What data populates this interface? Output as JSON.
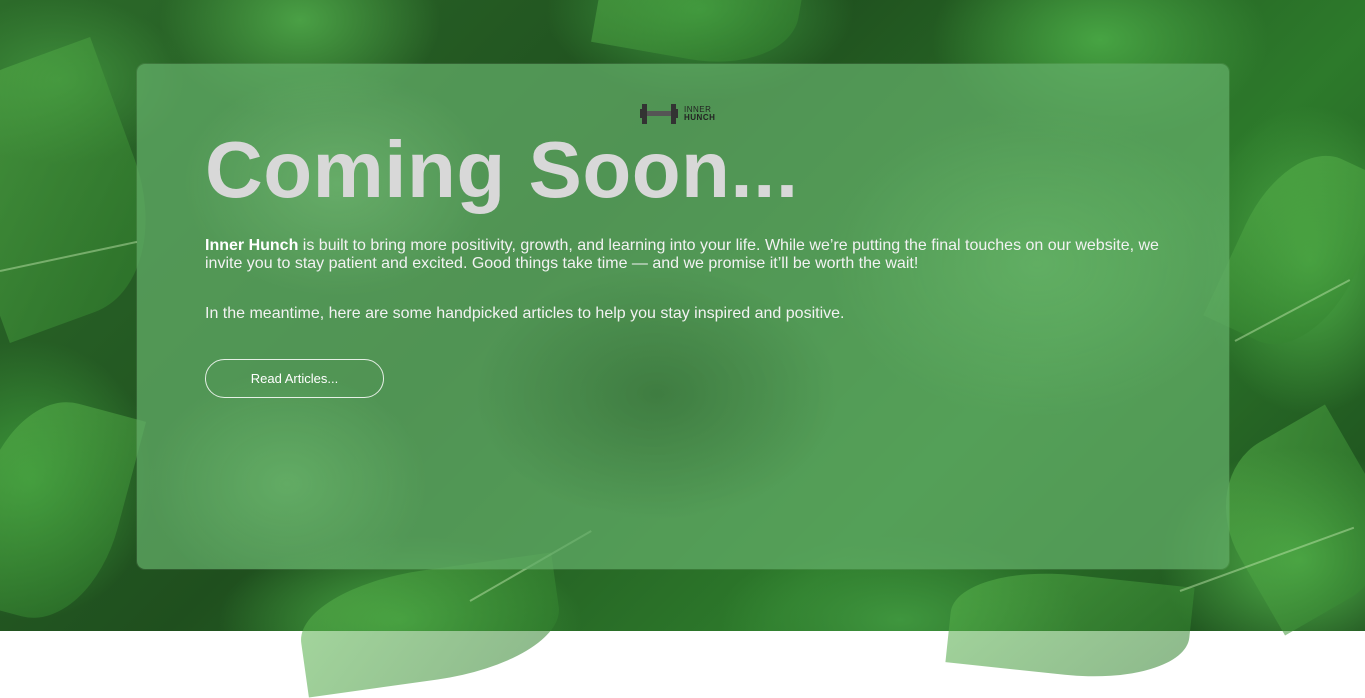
{
  "brand": {
    "logo_line1": "INNER",
    "logo_line2": "HUNCH",
    "name": "Inner Hunch"
  },
  "hero": {
    "title": "Coming Soon...",
    "intro_rest": " is built to bring more positivity, growth, and learning into your life. While we’re putting the final touches on our website, we invite you to stay patient and excited. Good things take time — and we promise it’ll be worth the wait!",
    "meantime": "In the meantime, here are some handpicked articles to help you stay inspired and positive.",
    "button_label": "Read Articles..."
  },
  "colors": {
    "title": "#d8d8d8",
    "text": "#f2f2f2",
    "logo": "#222222",
    "card_overlay": "#64af69"
  },
  "icons": {
    "logo": "h-barbell-logo-icon"
  }
}
